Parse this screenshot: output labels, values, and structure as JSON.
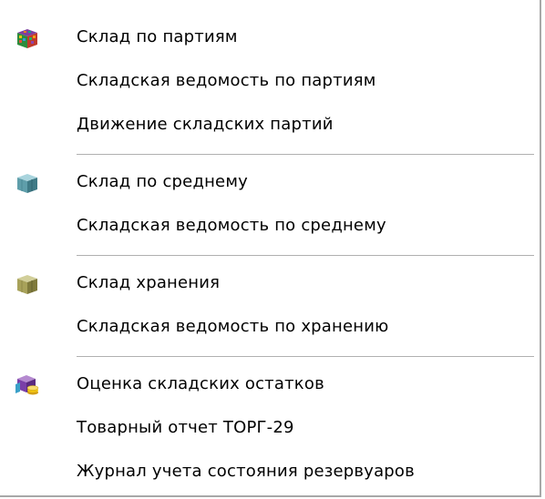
{
  "menu": {
    "groups": [
      {
        "items": [
          {
            "label": "Склад по партиям",
            "icon": "multicolor-cube-icon"
          },
          {
            "label": "Складская ведомость по партиям"
          },
          {
            "label": "Движение складских партий"
          }
        ]
      },
      {
        "items": [
          {
            "label": "Склад по среднему",
            "icon": "teal-cube-icon"
          },
          {
            "label": "Складская ведомость по среднему"
          }
        ]
      },
      {
        "items": [
          {
            "label": "Склад хранения",
            "icon": "olive-cube-icon"
          },
          {
            "label": "Складская ведомость по хранению"
          }
        ]
      },
      {
        "items": [
          {
            "label": "Оценка складских остатков",
            "icon": "cube-with-coins-icon"
          },
          {
            "label": "Товарный отчет ТОРГ-29"
          },
          {
            "label": "Журнал учета состояния резервуаров"
          }
        ]
      }
    ]
  },
  "colors": {
    "background": "#ffffff",
    "separator": "#b0b0b0",
    "text": "#000000"
  }
}
